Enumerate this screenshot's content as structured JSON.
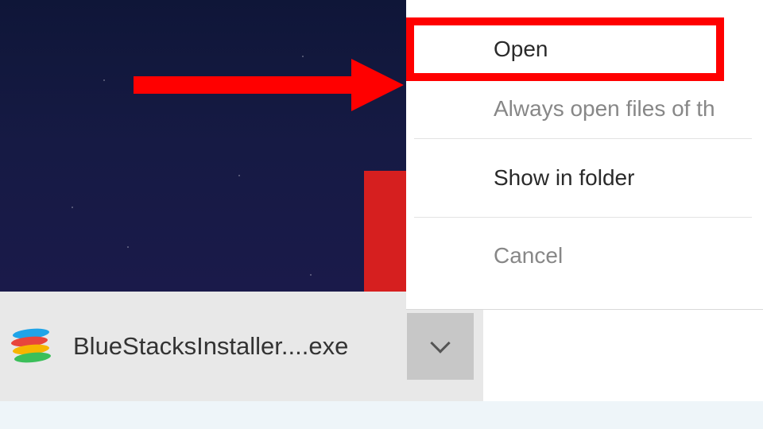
{
  "context_menu": {
    "items": [
      {
        "key": "open",
        "label": "Open",
        "enabled": true,
        "highlighted": true
      },
      {
        "key": "always",
        "label": "Always open files of th",
        "enabled": false,
        "highlighted": false
      },
      {
        "key": "show",
        "label": "Show in folder",
        "enabled": true,
        "highlighted": false
      },
      {
        "key": "cancel",
        "label": "Cancel",
        "enabled": false,
        "highlighted": false
      }
    ]
  },
  "download_bar": {
    "file_name": "BlueStacksInstaller....exe",
    "icon": "bluestacks-icon"
  },
  "annotation": {
    "arrow_target": "open",
    "highlight_target": "open",
    "colors": {
      "arrow": "#ff0000",
      "box": "#ff0000"
    }
  }
}
